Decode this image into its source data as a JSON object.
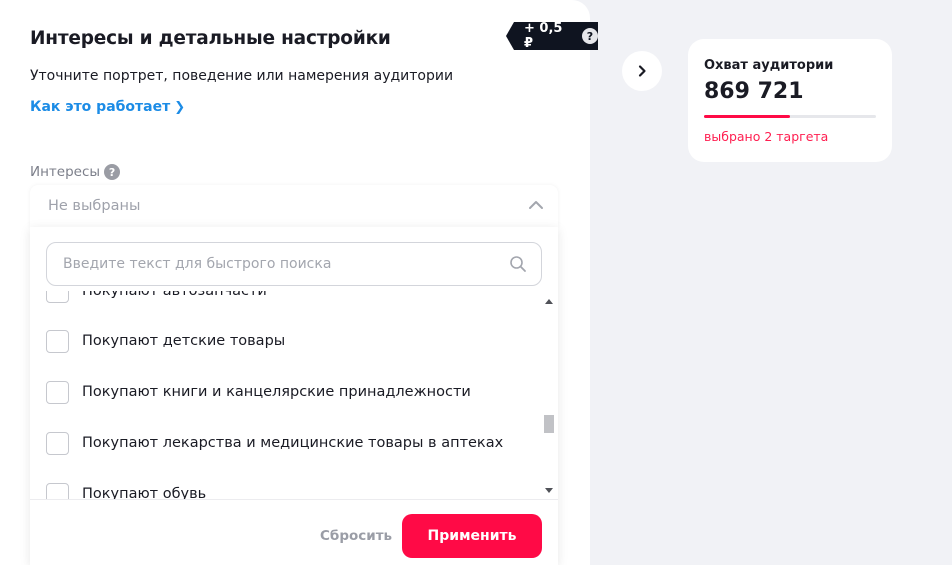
{
  "header": {
    "title": "Интересы и детальные настройки",
    "subtitle": "Уточните портрет, поведение или намерения аудитории",
    "how_link": "Как это работает",
    "price_badge": "+ 0,5 ₽"
  },
  "interests": {
    "label": "Интересы",
    "selected_value": "Не выбраны",
    "search_placeholder": "Введите текст для быстрого поиска",
    "search_value": "",
    "items": [
      {
        "label": "Покупают автозапчасти",
        "checked": false
      },
      {
        "label": "Покупают детские товары",
        "checked": false
      },
      {
        "label": "Покупают книги и канцелярские принадлежности",
        "checked": false
      },
      {
        "label": "Покупают лекарства и медицинские товары в аптеках",
        "checked": false
      },
      {
        "label": "Покупают обувь",
        "checked": false
      }
    ],
    "reset_label": "Сбросить",
    "apply_label": "Применить"
  },
  "reach": {
    "title": "Охват аудитории",
    "value": "869 721",
    "progress_fraction": 0.5,
    "note": "выбрано 2 таргета"
  },
  "icons": {
    "help": "question-circle-icon",
    "nav": "chevron-right-icon",
    "search": "magnifier-icon",
    "collapse": "chevron-up-icon"
  },
  "colors": {
    "accent": "#ff0a46",
    "link": "#1c8ce6",
    "badge_bg": "#0f1420",
    "page_bg": "#f1f2f6"
  }
}
